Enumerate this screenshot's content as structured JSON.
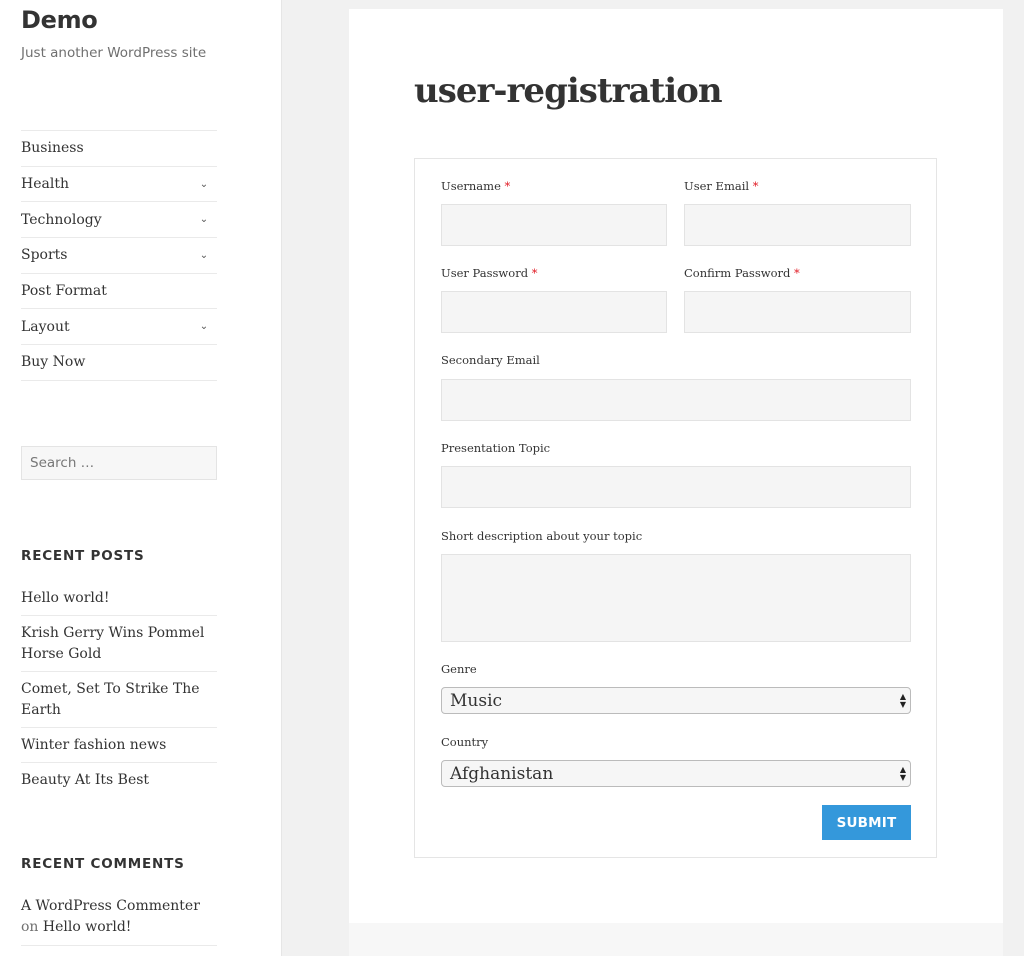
{
  "site": {
    "title": "Demo",
    "description": "Just another WordPress site"
  },
  "menu": [
    {
      "label": "Business",
      "has_submenu": false
    },
    {
      "label": "Health",
      "has_submenu": true
    },
    {
      "label": "Technology",
      "has_submenu": true
    },
    {
      "label": "Sports",
      "has_submenu": true
    },
    {
      "label": "Post Format",
      "has_submenu": false
    },
    {
      "label": "Layout",
      "has_submenu": true
    },
    {
      "label": "Buy Now",
      "has_submenu": false
    }
  ],
  "search": {
    "placeholder": "Search …",
    "value": ""
  },
  "recent_posts": {
    "title": "RECENT POSTS",
    "items": [
      "Hello world!",
      "Krish Gerry Wins Pommel Horse Gold",
      "Comet, Set To Strike The Earth",
      "Winter fashion news",
      "Beauty At Its Best"
    ]
  },
  "recent_comments": {
    "title": "RECENT COMMENTS",
    "items": [
      {
        "author": "A WordPress Commenter",
        "on": "on",
        "post": "Hello world!"
      }
    ]
  },
  "page": {
    "title": "user-registration"
  },
  "form": {
    "required_marker": "*",
    "fields": {
      "username": {
        "label": "Username",
        "value": ""
      },
      "user_email": {
        "label": "User Email",
        "value": ""
      },
      "user_password": {
        "label": "User Password",
        "value": ""
      },
      "confirm_password": {
        "label": "Confirm Password",
        "value": ""
      },
      "secondary_email": {
        "label": "Secondary Email",
        "value": ""
      },
      "presentation_topic": {
        "label": "Presentation Topic",
        "value": ""
      },
      "short_description": {
        "label": "Short description about your topic",
        "value": ""
      }
    },
    "genre": {
      "label": "Genre",
      "selected": "Music"
    },
    "country": {
      "label": "Country",
      "selected": "Afghanistan"
    },
    "submit_label": "SUBMIT"
  },
  "icons": {
    "chevron": "⌄",
    "arrow_up": "▲",
    "arrow_down": "▼"
  },
  "colors": {
    "accent": "#3498db",
    "required": "#e0141e"
  }
}
